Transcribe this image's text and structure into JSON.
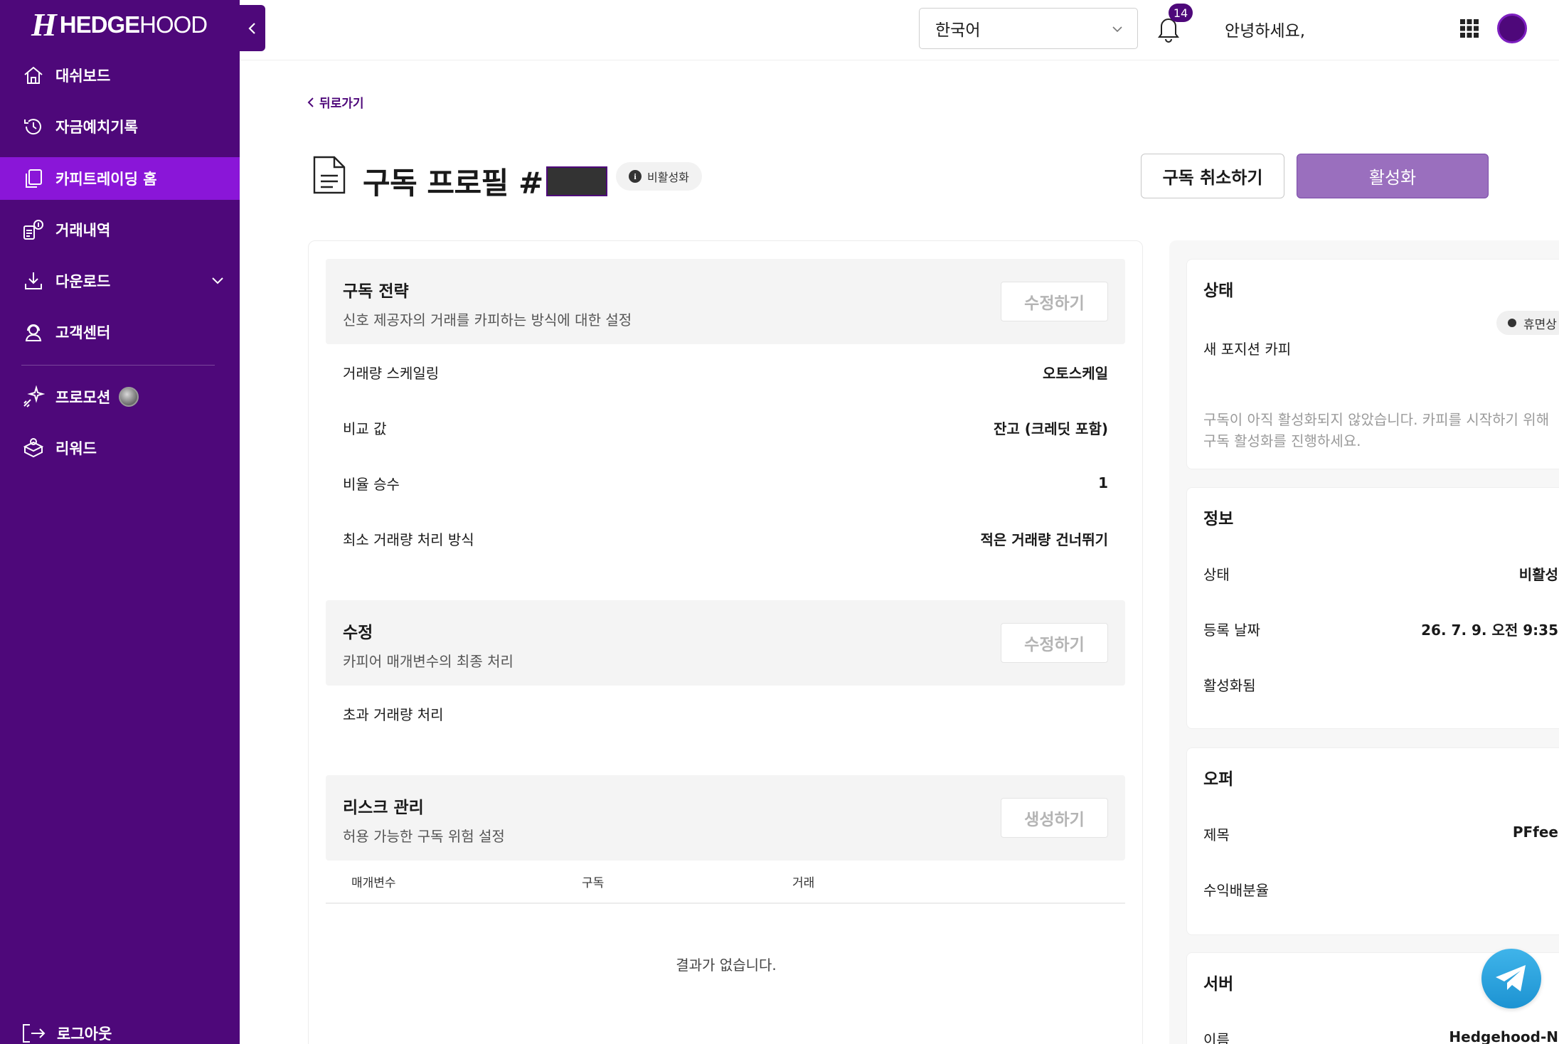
{
  "brand": {
    "mark": "H",
    "name_bold": "HEDGE",
    "name_light": "HOOD"
  },
  "sidebar": {
    "items": [
      {
        "label": "대쉬보드",
        "icon": "home-icon"
      },
      {
        "label": "자금예치기록",
        "icon": "history-icon"
      },
      {
        "label": "카피트레이딩 홈",
        "icon": "copy-icon",
        "active": true
      },
      {
        "label": "거래내역",
        "icon": "trade-history-icon"
      },
      {
        "label": "다운로드",
        "icon": "download-icon"
      },
      {
        "label": "고객센터",
        "icon": "support-icon"
      },
      {
        "label": "프로모션",
        "icon": "sparkle-icon"
      },
      {
        "label": "리워드",
        "icon": "gift-icon"
      }
    ],
    "logout_label": "로그아웃"
  },
  "topbar": {
    "language": "한국어",
    "notification_count": "14",
    "greeting": "안녕하세요,"
  },
  "header": {
    "back_label": "뒤로가기",
    "title": "구독 프로필 #",
    "status_chip": "비활성화",
    "cancel_button": "구독 취소하기",
    "activate_button": "활성화"
  },
  "strategy": {
    "title": "구독 전략",
    "description": "신호 제공자의 거래를 카피하는 방식에 대한 설정",
    "edit_label": "수정하기",
    "rows": [
      {
        "key": "거래량 스케일링",
        "value": "오토스케일"
      },
      {
        "key": "비교 값",
        "value": "잔고 (크레딧 포함)"
      },
      {
        "key": "비율 승수",
        "value": "1"
      },
      {
        "key": "최소 거래량 처리 방식",
        "value": "적은 거래량 건너뛰기"
      }
    ]
  },
  "modification": {
    "title": "수정",
    "description": "카피어 매개변수의 최종 처리",
    "edit_label": "수정하기",
    "rows": [
      {
        "key": "초과 거래량 처리",
        "value": ""
      }
    ]
  },
  "risk": {
    "title": "리스크 관리",
    "description": "허용 가능한 구독 위험 설정",
    "create_label": "생성하기",
    "columns": [
      "매개변수",
      "구독",
      "거래"
    ],
    "empty_text": "결과가 없습니다."
  },
  "status_card": {
    "title": "상태",
    "copy_label": "새 포지션 카피",
    "copy_status": "휴면상",
    "note_line1": "구독이 아직 활성화되지 않았습니다. 카피를 시작하기 위해",
    "note_line2": "구독 활성화를 진행하세요."
  },
  "info_card": {
    "title": "정보",
    "rows": [
      {
        "key": "상태",
        "value": "비활성"
      },
      {
        "key": "등록 날짜",
        "value": "26. 7. 9. 오전 9:35"
      },
      {
        "key": "활성화됨",
        "value": ""
      }
    ]
  },
  "offer_card": {
    "title": "오퍼",
    "rows": [
      {
        "key": "제목",
        "value": "PFfee"
      },
      {
        "key": "수익배분율",
        "value": ""
      }
    ]
  },
  "server_card": {
    "title": "서버",
    "rows": [
      {
        "key": "이름",
        "value": "Hedgehood-N"
      }
    ]
  },
  "colors": {
    "sidebar": "#4e087a",
    "active_item": "#8a16d8",
    "activate_button": "#9a6fbe"
  }
}
